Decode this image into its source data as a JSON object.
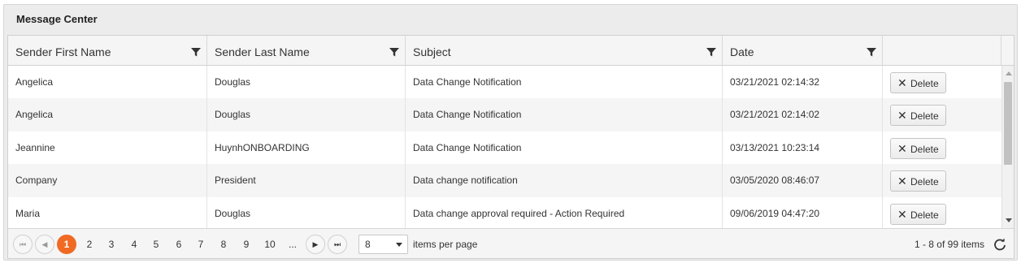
{
  "panel": {
    "title": "Message Center"
  },
  "columns": [
    "Sender First Name",
    "Sender Last Name",
    "Subject",
    "Date",
    ""
  ],
  "rows": [
    {
      "first": "Angelica",
      "last": "Douglas",
      "subject": "Data Change Notification",
      "date": "03/21/2021 02:14:32",
      "action": "Delete"
    },
    {
      "first": "Angelica",
      "last": "Douglas",
      "subject": "Data Change Notification",
      "date": "03/21/2021 02:14:02",
      "action": "Delete"
    },
    {
      "first": "Jeannine",
      "last": "HuynhONBOARDING",
      "subject": "Data Change Notification",
      "date": "03/13/2021 10:23:14",
      "action": "Delete"
    },
    {
      "first": "Company",
      "last": "President",
      "subject": "Data change notification",
      "date": "03/05/2020 08:46:07",
      "action": "Delete"
    },
    {
      "first": "Maria",
      "last": "Douglas",
      "subject": "Data change approval required - Action Required",
      "date": "09/06/2019 04:47:20",
      "action": "Delete"
    }
  ],
  "pager": {
    "first_icon": "first-page-icon",
    "prev_icon": "previous-page-icon",
    "next_icon": "next-page-icon",
    "last_icon": "last-page-icon",
    "pages": [
      "1",
      "2",
      "3",
      "4",
      "5",
      "6",
      "7",
      "8",
      "9",
      "10",
      "..."
    ],
    "current_page": "1",
    "page_size": "8",
    "items_per_page_label": "items per page",
    "info": "1 - 8 of 99 items",
    "refresh_icon": "refresh-icon"
  },
  "colors": {
    "accent": "#f06a24",
    "header_bg": "#f5f5f5",
    "panel_bg": "#ececec"
  }
}
